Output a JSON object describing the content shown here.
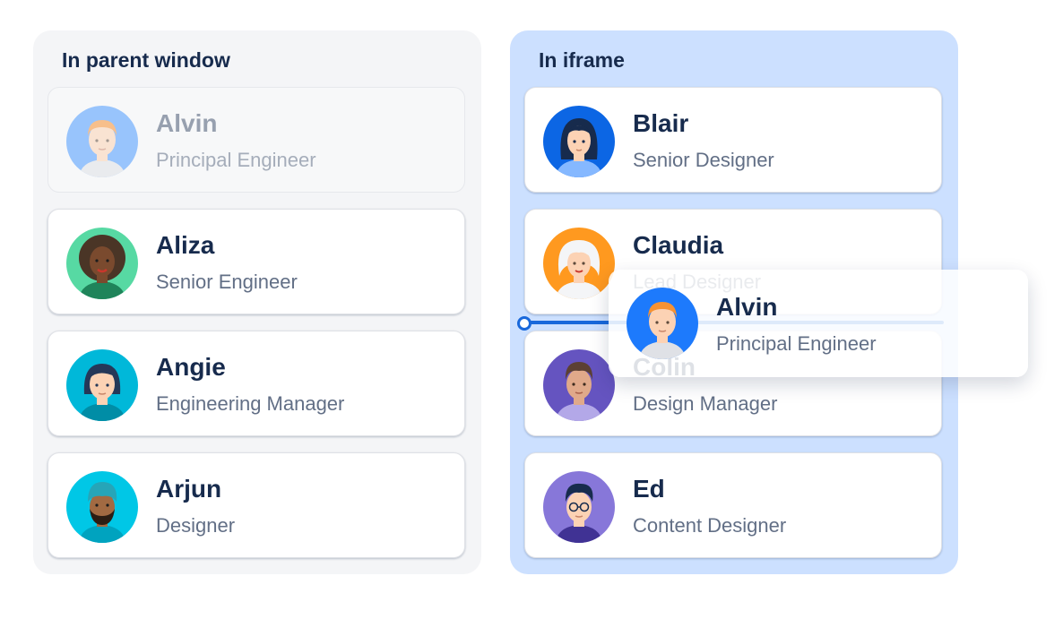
{
  "parent": {
    "title": "In parent window",
    "cards": [
      {
        "name": "Alvin",
        "role": "Principal Engineer",
        "avatar": "avatar-ginger-man",
        "state": "dragging-source"
      },
      {
        "name": "Aliza",
        "role": "Senior Engineer",
        "avatar": "avatar-curly-hair-woman"
      },
      {
        "name": "Angie",
        "role": "Engineering Manager",
        "avatar": "avatar-dark-bob-woman"
      },
      {
        "name": "Arjun",
        "role": "Designer",
        "avatar": "avatar-turban-man"
      }
    ]
  },
  "iframe": {
    "title": "In iframe",
    "cards": [
      {
        "name": "Blair",
        "role": "Senior Designer",
        "avatar": "avatar-long-hair-woman"
      },
      {
        "name": "Claudia",
        "role": "Lead Designer",
        "avatar": "avatar-white-hair-woman"
      },
      {
        "name": "Colin",
        "role": "Design Manager",
        "avatar": "avatar-brown-hair-man"
      },
      {
        "name": "Ed",
        "role": "Content Designer",
        "avatar": "avatar-glasses-man"
      }
    ]
  },
  "drag_preview": {
    "name": "Alvin",
    "role": "Principal Engineer",
    "avatar": "avatar-ginger-man"
  },
  "colors": {
    "drop_indicator": "#1868db",
    "iframe_bg": "#cce0ff",
    "parent_bg": "#f4f5f7",
    "title_text": "#172b4d",
    "secondary_text": "#626f86"
  }
}
